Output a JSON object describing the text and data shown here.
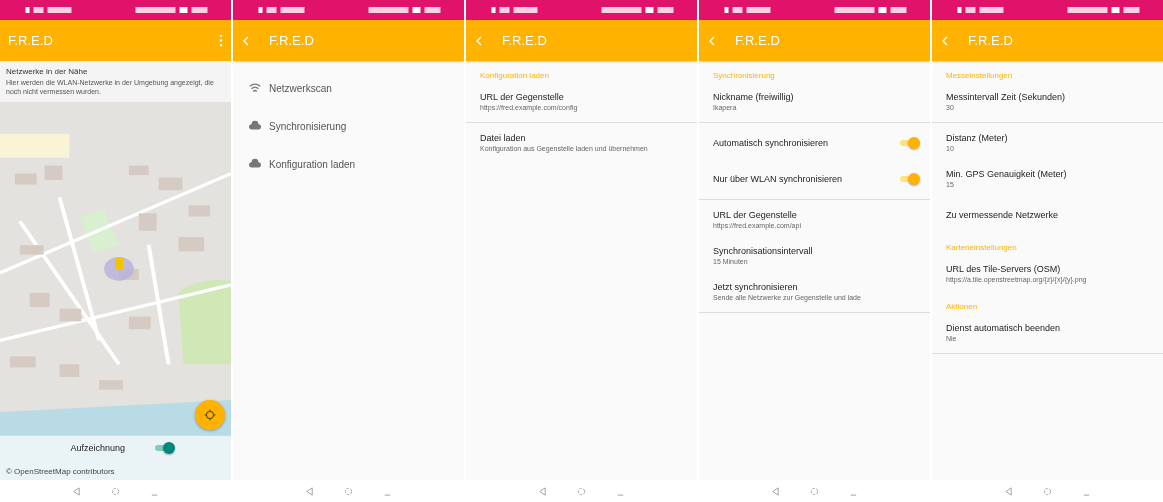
{
  "screens": [
    {
      "kind": "map",
      "app_bar": {
        "title": "F.R.E.D",
        "back": false,
        "menu": true
      },
      "info_card": {
        "title": "Netzwerke in der Nähe",
        "text": "Hier werden die WLAN-Netzwerke in der Umgebung angezeigt, die noch nicht vermessen wurden."
      },
      "recording": {
        "label": "Aufzeichnung",
        "on": true
      },
      "attribution": "© OpenStreetMap contributors"
    },
    {
      "kind": "menu",
      "app_bar": {
        "title": "F.R.E.D",
        "back": true,
        "menu": false
      },
      "items": [
        {
          "label": "Netzwerkscan"
        },
        {
          "label": "Synchronisierung"
        },
        {
          "label": "Konfiguration laden"
        }
      ]
    },
    {
      "kind": "prefs",
      "app_bar": {
        "title": "F.R.E.D",
        "back": true,
        "menu": false
      },
      "items": [
        {
          "kind": "header",
          "title": "Konfiguration laden"
        },
        {
          "kind": "item",
          "title": "URL der Gegenstelle",
          "summary": "https://fred.example.com/config"
        },
        {
          "kind": "divider"
        },
        {
          "kind": "item",
          "title": "Datei laden",
          "summary": "Konfiguration aus Gegenstelle laden und übernehmen"
        }
      ]
    },
    {
      "kind": "prefs",
      "app_bar": {
        "title": "F.R.E.D",
        "back": true,
        "menu": false
      },
      "items": [
        {
          "kind": "header",
          "title": "Synchronisierung"
        },
        {
          "kind": "item",
          "title": "Nickname (freiwillig)",
          "summary": "Ikapera"
        },
        {
          "kind": "divider"
        },
        {
          "kind": "switch",
          "title": "Automatisch synchronisieren",
          "on": true
        },
        {
          "kind": "switch",
          "title": "Nur über WLAN synchronisieren",
          "on": true
        },
        {
          "kind": "divider"
        },
        {
          "kind": "item",
          "title": "URL der Gegenstelle",
          "summary": "https://fred.example.com/api"
        },
        {
          "kind": "item",
          "title": "Synchronisationsintervall",
          "summary": "15 Minuten"
        },
        {
          "kind": "item",
          "title": "Jetzt synchronisieren",
          "summary": "Sende alle Netzwerke zur Gegenstelle und lade"
        },
        {
          "kind": "divider"
        }
      ]
    },
    {
      "kind": "prefs",
      "app_bar": {
        "title": "F.R.E.D",
        "back": true,
        "menu": false
      },
      "items": [
        {
          "kind": "header",
          "title": "Messeinstellungen"
        },
        {
          "kind": "item",
          "title": "Messintervall Zeit (Sekunden)",
          "summary": "30"
        },
        {
          "kind": "divider"
        },
        {
          "kind": "item",
          "title": "Distanz (Meter)",
          "summary": "10"
        },
        {
          "kind": "item",
          "title": "Min. GPS Genauigkeit (Meter)",
          "summary": "15"
        },
        {
          "kind": "item",
          "title": "Zu vermessende Netzwerke"
        },
        {
          "kind": "header",
          "title": "Karteneinstellungen"
        },
        {
          "kind": "item",
          "title": "URL des Tile-Servers (OSM)",
          "summary": "https://a.tile.openstreetmap.org/{z}/{x}/{y}.png"
        },
        {
          "kind": "header",
          "title": "Aktionen"
        },
        {
          "kind": "item",
          "title": "Dienst automatisch beenden",
          "summary": "Nie"
        },
        {
          "kind": "divider"
        }
      ]
    }
  ]
}
